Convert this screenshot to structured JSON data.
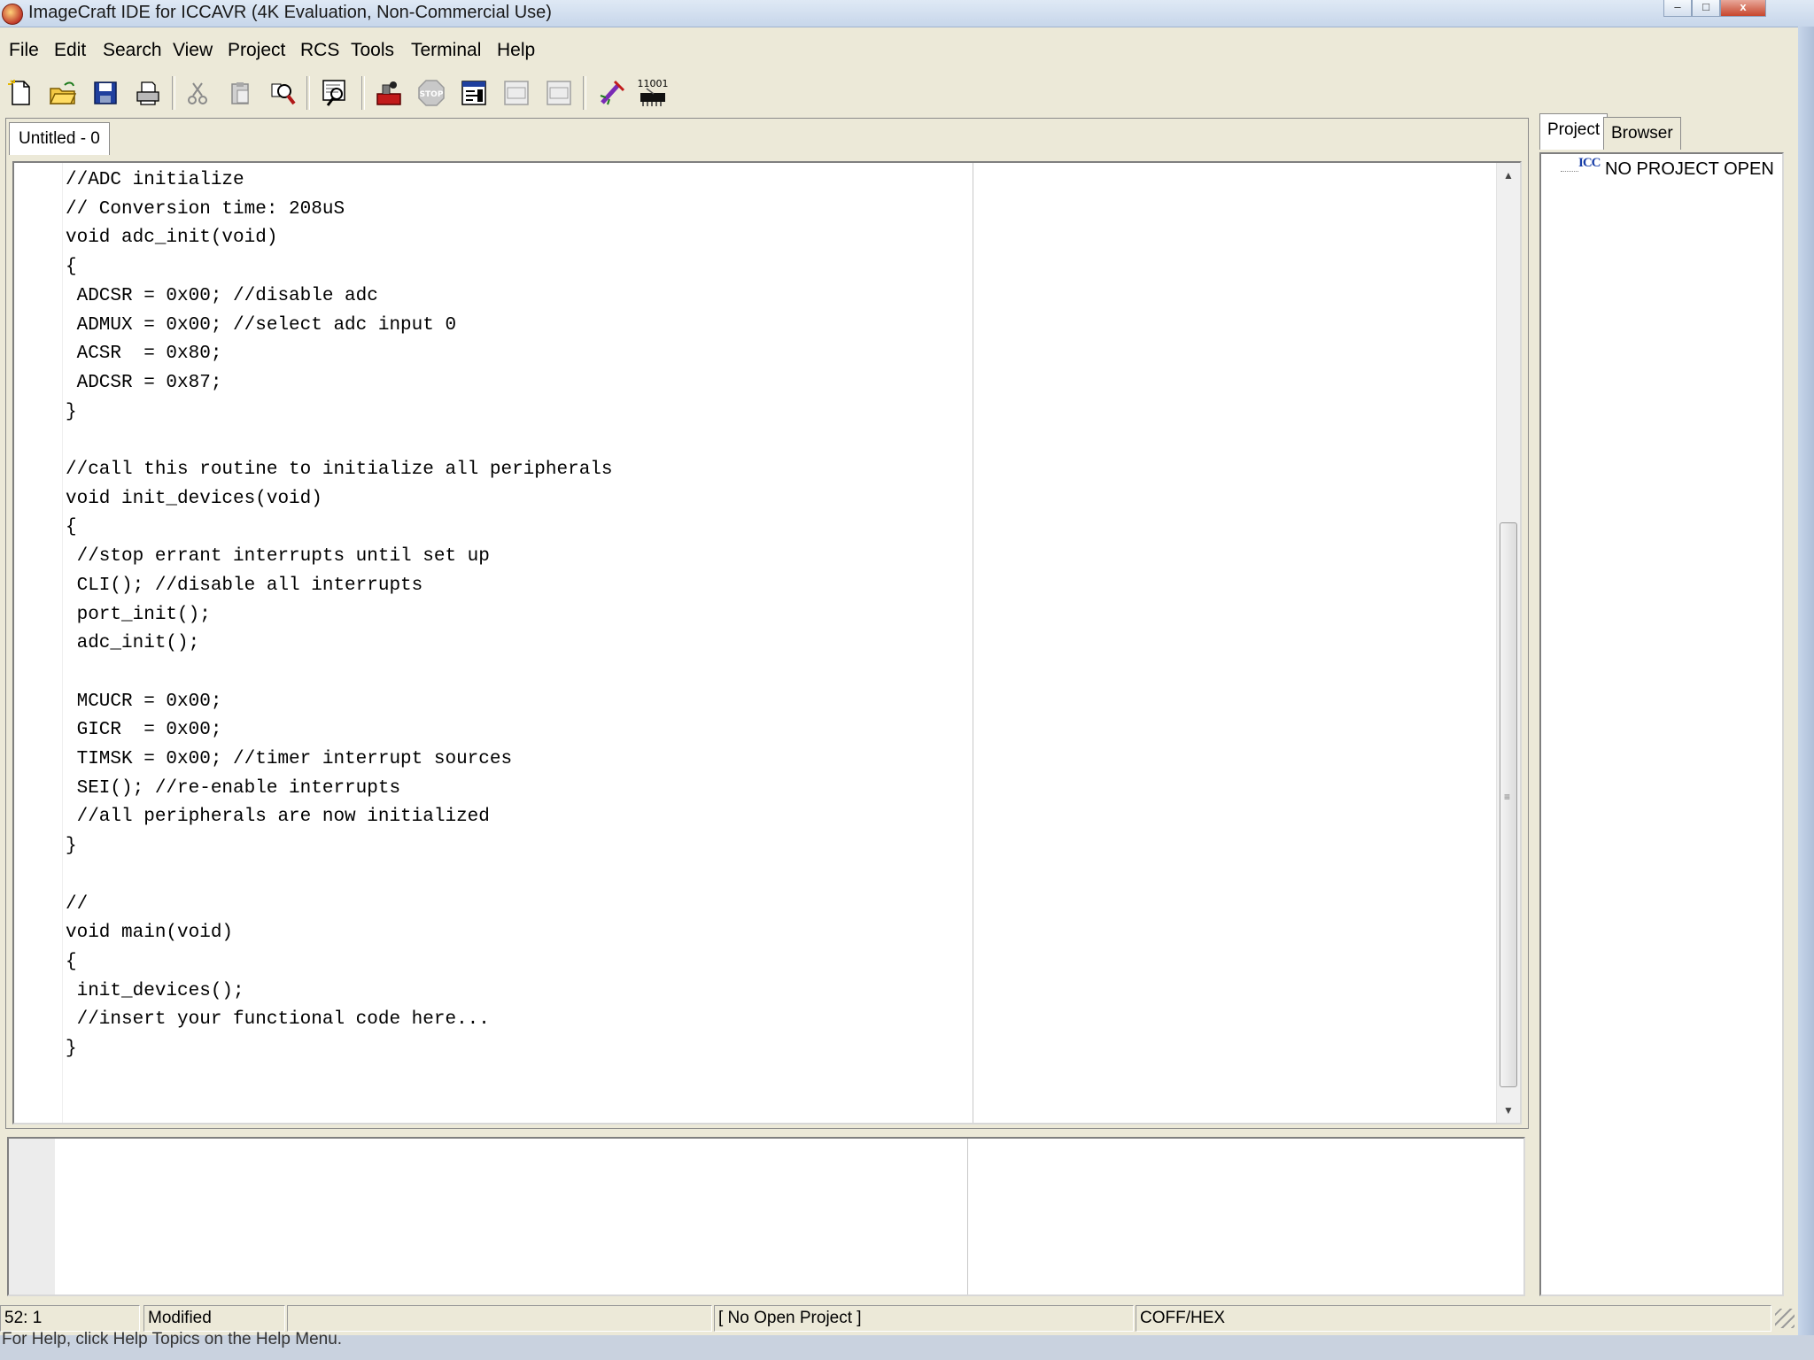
{
  "window": {
    "title": "ImageCraft IDE for ICCAVR (4K Evaluation, Non-Commercial Use)",
    "icon": "imagecraft-app-icon"
  },
  "menu": {
    "items": [
      "File",
      "Edit",
      "Search",
      "View",
      "Project",
      "RCS",
      "Tools",
      "Terminal",
      "Help"
    ]
  },
  "toolbar": {
    "buttons": [
      {
        "icon": "new-file-icon"
      },
      {
        "icon": "open-folder-icon"
      },
      {
        "icon": "save-icon"
      },
      {
        "icon": "print-icon"
      },
      {
        "icon": "cut-icon"
      },
      {
        "icon": "paste-icon"
      },
      {
        "icon": "find-icon"
      },
      {
        "icon": "find-in-files-icon"
      },
      {
        "icon": "build-icon"
      },
      {
        "icon": "stop-icon"
      },
      {
        "icon": "compile-to-output-icon"
      },
      {
        "icon": "make-disabled-icon"
      },
      {
        "icon": "make-all-disabled-icon"
      },
      {
        "icon": "application-builder-icon"
      },
      {
        "icon": "isp-programmer-icon",
        "label": "11001"
      }
    ]
  },
  "editor": {
    "tab_label": "Untitled - 0",
    "code": "//ADC initialize\n// Conversion time: 208uS\nvoid adc_init(void)\n{\n ADCSR = 0x00; //disable adc\n ADMUX = 0x00; //select adc input 0\n ACSR  = 0x80;\n ADCSR = 0x87;\n}\n\n//call this routine to initialize all peripherals\nvoid init_devices(void)\n{\n //stop errant interrupts until set up\n CLI(); //disable all interrupts\n port_init();\n adc_init();\n\n MCUCR = 0x00;\n GICR  = 0x00;\n TIMSK = 0x00; //timer interrupt sources\n SEI(); //re-enable interrupts\n //all peripherals are now initialized\n}\n\n//\nvoid main(void)\n{\n init_devices();\n //insert your functional code here...\n}"
  },
  "side_panel": {
    "tabs": [
      "Project",
      "Browser"
    ],
    "active_tab": "Project",
    "tree_root": "NO PROJECT OPEN",
    "tree_icon_text": "ICC"
  },
  "status": {
    "position": "52: 1",
    "modified": "Modified",
    "project": "[ No Open Project ]",
    "output_format": "COFF/HEX"
  },
  "hint": "For Help, click Help Topics on the Help Menu."
}
